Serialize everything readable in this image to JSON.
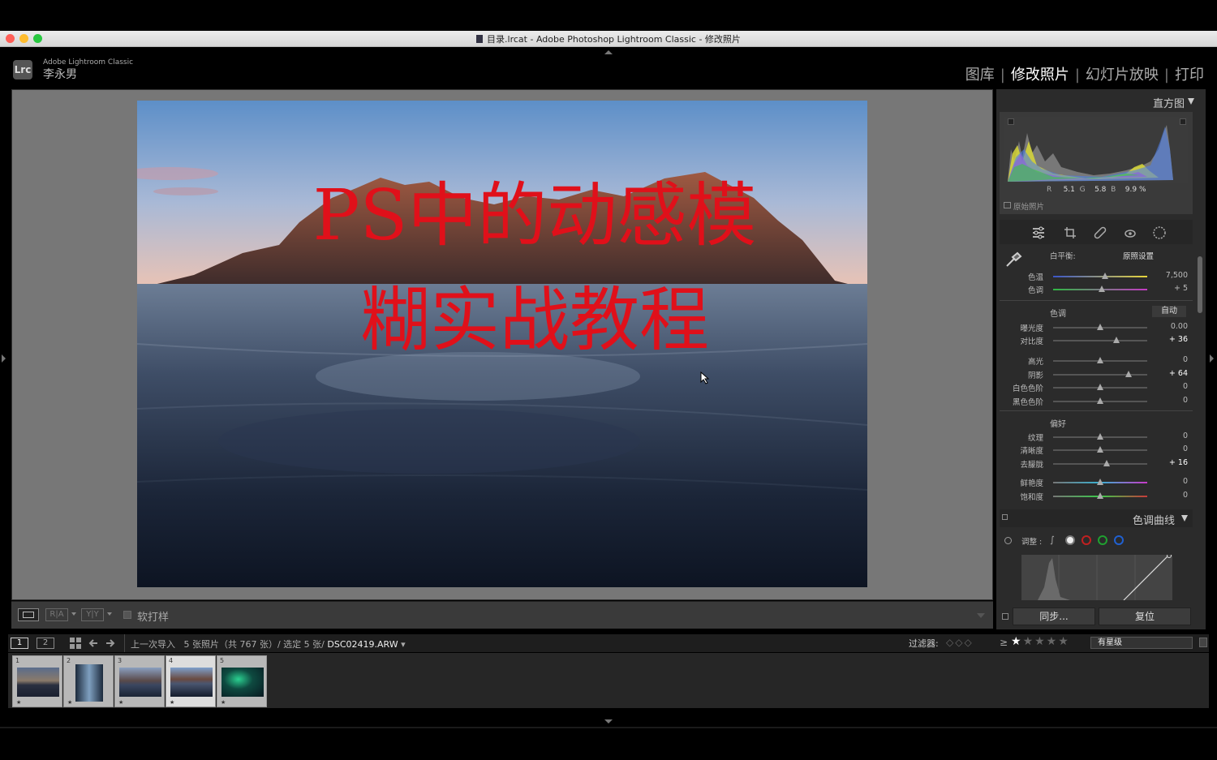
{
  "window": {
    "title": "目录.lrcat - Adobe Photoshop Lightroom Classic - 修改照片"
  },
  "identity": {
    "product": "Adobe Lightroom Classic",
    "user": "李永男",
    "badge": "Lrc"
  },
  "modules": {
    "library": "图库",
    "develop": "修改照片",
    "slideshow": "幻灯片放映",
    "print": "打印",
    "separator": "|"
  },
  "photo": {
    "overlay_line1": "PS中的动感模",
    "overlay_line2": "糊实战教程"
  },
  "toolbar": {
    "soft_proof": "软打样",
    "view_ra": "R|A",
    "view_yy": "Y|Y"
  },
  "histogram": {
    "title": "直方图",
    "r_label": "R",
    "r_value": "5.1",
    "g_label": "G",
    "g_value": "5.8",
    "b_label": "B",
    "b_value": "9.9 %",
    "original": "原始照片"
  },
  "basic": {
    "wb_label": "白平衡:",
    "wb_value": "原照设置",
    "tone_label": "色调",
    "auto_label": "自动",
    "presence_label": "偏好",
    "wb_sliders": [
      {
        "label": "色温",
        "value": "7,500",
        "pos": 0.55
      },
      {
        "label": "色调",
        "value": "+ 5",
        "pos": 0.52
      }
    ],
    "tone_sliders": [
      {
        "label": "曝光度",
        "value": "0.00",
        "pos": 0.5
      },
      {
        "label": "对比度",
        "value": "+ 36",
        "pos": 0.68
      }
    ],
    "tone_sliders2": [
      {
        "label": "高光",
        "value": "0",
        "pos": 0.5
      },
      {
        "label": "阴影",
        "value": "+ 64",
        "pos": 0.8
      },
      {
        "label": "白色色阶",
        "value": "0",
        "pos": 0.5
      },
      {
        "label": "黑色色阶",
        "value": "0",
        "pos": 0.5
      }
    ],
    "presence_sliders": [
      {
        "label": "纹理",
        "value": "0",
        "pos": 0.5
      },
      {
        "label": "清晰度",
        "value": "0",
        "pos": 0.5
      },
      {
        "label": "去朦胧",
        "value": "+ 16",
        "pos": 0.57
      }
    ],
    "presence_sliders2": [
      {
        "label": "鲜艳度",
        "value": "0",
        "pos": 0.5
      },
      {
        "label": "饱和度",
        "value": "0",
        "pos": 0.5
      }
    ]
  },
  "tone_curve": {
    "title": "色调曲线",
    "adjust_label": "调整 :"
  },
  "actions": {
    "sync": "同步...",
    "reset": "复位"
  },
  "filmbar": {
    "page1": "1",
    "page2": "2",
    "source": "上一次导入",
    "count": "5 张照片（共 767 张）/ 选定 5 张/",
    "filename": "DSC02419.ARW",
    "filter_label": "过滤器:",
    "rating_op": "≥",
    "rating_mode": "有星级"
  },
  "thumbnails": [
    {
      "num": "1",
      "star": "★"
    },
    {
      "num": "2",
      "star": "★"
    },
    {
      "num": "3",
      "star": "★"
    },
    {
      "num": "4",
      "star": "★"
    },
    {
      "num": "5",
      "star": "★"
    }
  ],
  "colors": {
    "accent_red": "#e0101a",
    "panel_bg": "#2b2b2b"
  }
}
